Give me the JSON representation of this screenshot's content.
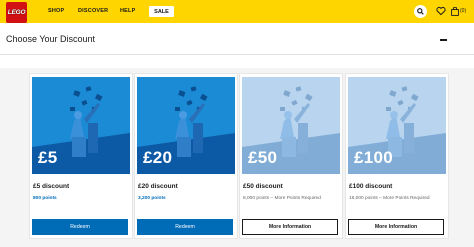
{
  "header": {
    "logo_text": "LEGO",
    "nav": [
      {
        "label": "SHOP"
      },
      {
        "label": "DISCOVER"
      },
      {
        "label": "HELP"
      }
    ],
    "sale_label": "SALE",
    "bag_count": "(0)",
    "icons": [
      "search-icon",
      "heart-icon",
      "bag-icon"
    ],
    "colors": {
      "bar": "#ffd500",
      "logo": "#d01012"
    }
  },
  "section": {
    "title": "Choose Your Discount",
    "collapse_icon": "minus-icon"
  },
  "cards": [
    {
      "value": "£5",
      "name": "£5 discount",
      "points": "800 points",
      "button": "Redeem",
      "available": true
    },
    {
      "value": "£20",
      "name": "£20 discount",
      "points": "3,200 points",
      "button": "Redeem",
      "available": true
    },
    {
      "value": "£50",
      "name": "£50 discount",
      "points": "8,000 points – More Points Required",
      "button": "More Information",
      "available": false
    },
    {
      "value": "£100",
      "name": "£100 discount",
      "points": "16,000 points – More Points Required",
      "button": "More Information",
      "available": false
    }
  ],
  "colors": {
    "primary": "#006cb7",
    "card_blue": "#1c8bd6",
    "card_faded": "#b9d4ee"
  }
}
